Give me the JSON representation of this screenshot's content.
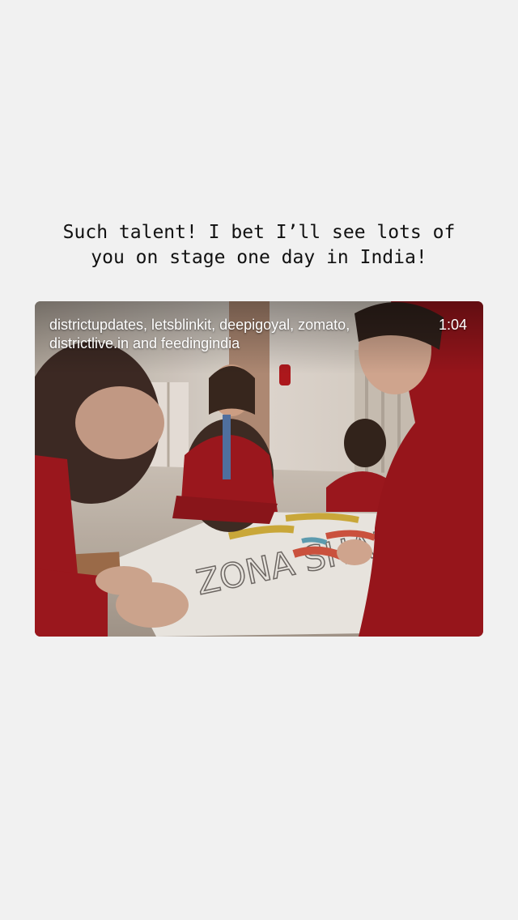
{
  "post": {
    "caption": "Such talent! I bet I’ll see lots of\nyou on stage one day in India!"
  },
  "video": {
    "collaborators": "districtupdates, letsblinkit, deepigoyal, zomato, districtlive.in and feedingindia",
    "duration": "1:04",
    "poster_text": "ZONA SHAKE"
  },
  "colors": {
    "background": "#f1f1f1",
    "uniform_red": "#a0141c",
    "text_dark": "#111111",
    "overlay_text": "#ffffff"
  }
}
